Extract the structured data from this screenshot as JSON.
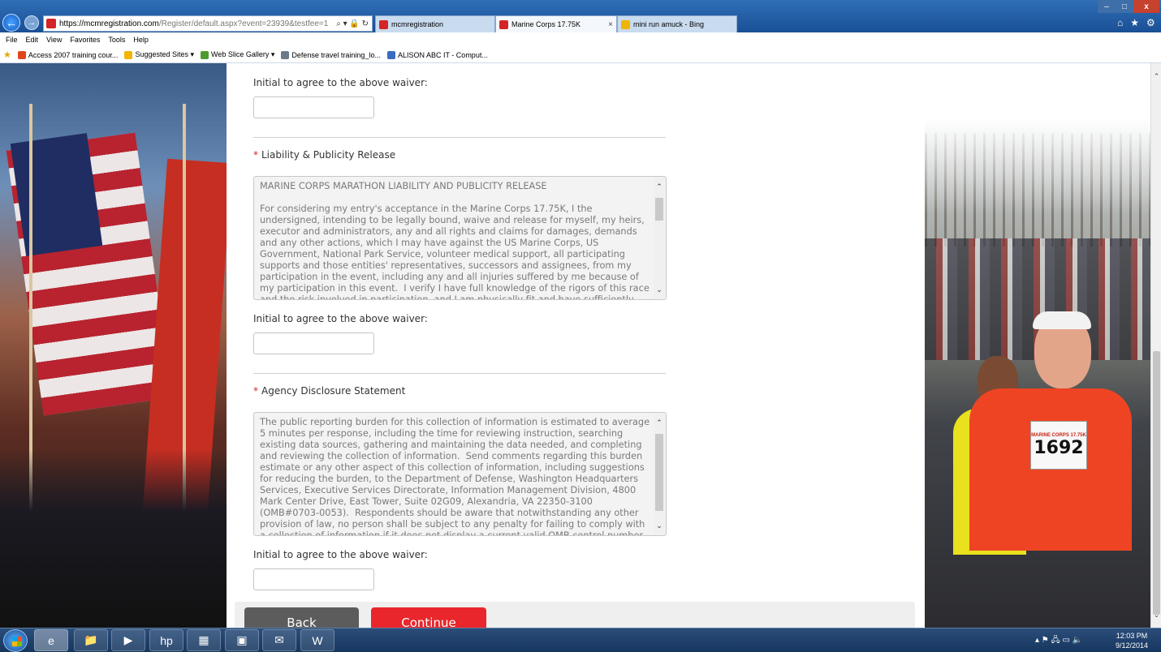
{
  "browser": {
    "address": {
      "url_main": "https://mcmregistration.com",
      "url_rest": "/Register/default.aspx?event=23939&testfee=1",
      "tools": "⌕ ▾ 🔒 ↻"
    },
    "tabs": [
      {
        "label": "mcmregistration",
        "icon": "page-icon"
      },
      {
        "label": "Marine Corps 17.75K",
        "icon": "page-icon"
      },
      {
        "label": "mini run amuck - Bing",
        "icon": "bing-icon"
      }
    ],
    "tab_close": "×",
    "menu": [
      "File",
      "Edit",
      "View",
      "Favorites",
      "Tools",
      "Help"
    ],
    "favorites": [
      {
        "label": "Access 2007 training cour...",
        "color": "#e0461d"
      },
      {
        "label": "Suggested Sites ▾",
        "color": "#f1b400"
      },
      {
        "label": "Web Slice Gallery ▾",
        "color": "#4d9a2f"
      },
      {
        "label": "Defense travel training_lo...",
        "color": "#6a7a8a"
      },
      {
        "label": "ALISON ABC IT - Comput...",
        "color": "#3a6cc0"
      }
    ],
    "window_controls": {
      "minimize": "–",
      "maximize": "□",
      "close": "x"
    }
  },
  "form": {
    "initial_label": "Initial to agree to the above waiver:",
    "liability": {
      "title": "Liability & Publicity Release",
      "text": "MARINE CORPS MARATHON LIABILITY AND PUBLICITY RELEASE\n\nFor considering my entry's acceptance in the Marine Corps 17.75K, I the undersigned, intending to be legally bound, waive and release for myself, my heirs, executor and administrators, any and all rights and claims for damages, demands and any other actions, which I may have against the US Marine Corps, US Government, National Park Service, volunteer medical support, all participating supports and those entities' representatives, successors and assignees, from my participation in the event, including any and all injuries suffered by me because of my participation in this event.  I verify I have full knowledge of the rigors of this race and the risk involved in participation, and I am physically fit and have sufficiently trained to complete this"
    },
    "agency": {
      "title": "Agency Disclosure Statement",
      "text": "The public reporting burden for this collection of information is estimated to average 5 minutes per response, including the time for reviewing instruction, searching existing data sources, gathering and maintaining the data needed, and completing and reviewing the collection of information.  Send comments regarding this burden estimate or any other aspect of this collection of information, including suggestions for reducing the burden, to the Department of Defense, Washington Headquarters Services, Executive Services Directorate, Information Management Division, 4800 Mark Center Drive, East Tower, Suite 02G09, Alexandria, VA 22350-3100 (OMB#0703-0053).  Respondents should be aware that notwithstanding any other provision of law, no person shall be subject to any penalty for failing to comply with a collection of information if it does not display a current valid OMB control number."
    },
    "buttons": {
      "back": "Back",
      "continue": "Continue"
    },
    "colors": {
      "required": "#d9252a",
      "continue": "#e8262b",
      "back": "#5c5c5c"
    }
  },
  "photo": {
    "bib_number": "1692",
    "bib_header": "MARINE CORPS 17.75K"
  },
  "taskbar": {
    "clock_time": "12:03 PM",
    "clock_date": "9/12/2014",
    "tray": "▴  ⚑  🖧  ▭  🔈"
  }
}
